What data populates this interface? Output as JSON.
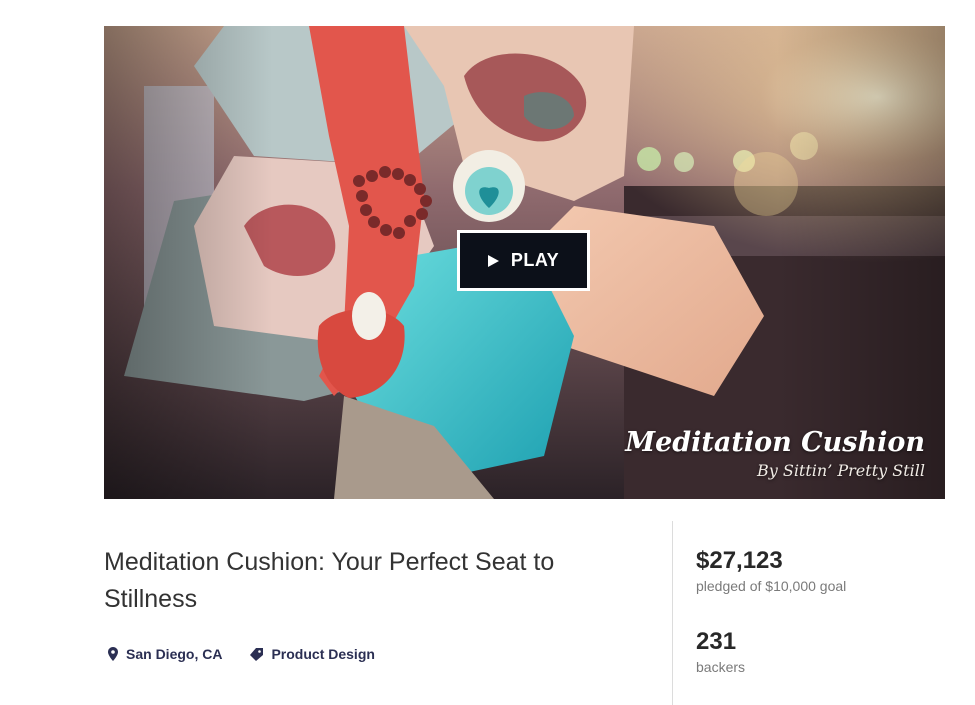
{
  "hero": {
    "play_label": "PLAY",
    "overlay_title": "Meditation Cushion",
    "overlay_subtitle": "By Sittin’ Pretty Still"
  },
  "project": {
    "title": "Meditation Cushion: Your Perfect Seat to Stillness",
    "location": "San Diego, CA",
    "category": "Product Design",
    "location_icon": "map-pin-icon",
    "category_icon": "tag-icon"
  },
  "stats": {
    "pledged": "$27,123",
    "pledged_label": "pledged of $10,000 goal",
    "backers": "231",
    "backers_label": "backers"
  },
  "colors": {
    "play_button_bg": "#0c1019",
    "meta_text": "#2b2f53"
  }
}
